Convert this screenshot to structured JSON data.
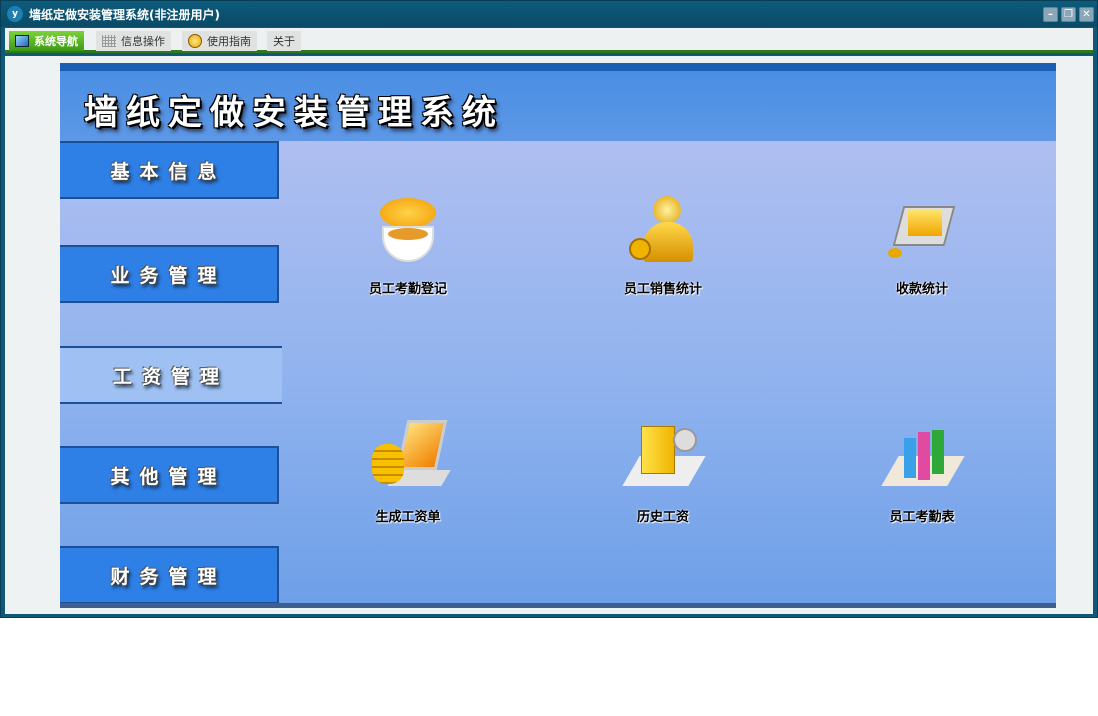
{
  "window": {
    "title": "墙纸定做安装管理系统(非注册用户)",
    "logo_text": "y"
  },
  "window_controls": {
    "minimize": "–",
    "restore": "❐",
    "close": "✕"
  },
  "toolbar": {
    "tabs": [
      {
        "label": "系统导航",
        "active": true
      },
      {
        "label": "信息操作"
      },
      {
        "label": "使用指南"
      },
      {
        "label": "关于"
      }
    ]
  },
  "header": {
    "title": "墙纸定做安装管理系统"
  },
  "menu": [
    "基本信息",
    "业务管理",
    "工资管理",
    "其他管理",
    "财务管理"
  ],
  "items": [
    "员工考勤登记",
    "员工销售统计",
    "收款统计",
    "生成工资单",
    "历史工资",
    "员工考勤表"
  ],
  "colors": {
    "accent": "#2e7fe6",
    "titlebar": "#0a4a66",
    "active_tab": "#3c9a15"
  }
}
